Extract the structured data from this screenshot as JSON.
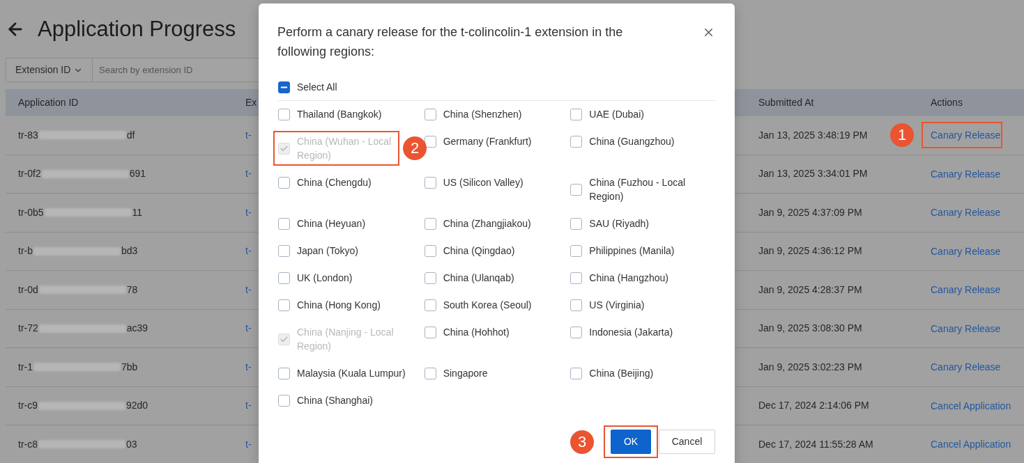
{
  "page": {
    "title": "Application Progress",
    "filter": {
      "field": "Extension ID",
      "placeholder": "Search by extension ID"
    }
  },
  "table": {
    "columns": [
      "Application ID",
      "Ex",
      "Submitted At",
      "Actions"
    ],
    "rows": [
      {
        "application_id": {
          "start": "tr-83",
          "end": "df"
        },
        "column_2": "t-",
        "submitted_at": "Jan 13, 2025 3:48:19 PM",
        "action": "Canary Release",
        "callout": {
          "number": "1"
        }
      },
      {
        "application_id": {
          "start": "tr-0f2",
          "end": "691"
        },
        "column_2": "t-",
        "submitted_at": "Jan 13, 2025 3:34:01 PM",
        "action": "Canary Release"
      },
      {
        "application_id": {
          "start": "tr-0b5",
          "end": "11"
        },
        "column_2": "t-",
        "submitted_at": "Jan 9, 2025 4:37:09 PM",
        "action": "Canary Release"
      },
      {
        "application_id": {
          "start": "tr-b",
          "end": "bd3"
        },
        "column_2": "t-",
        "submitted_at": "Jan 9, 2025 4:36:12 PM",
        "action": "Canary Release"
      },
      {
        "application_id": {
          "start": "tr-0d",
          "end": "78"
        },
        "column_2": "t-",
        "submitted_at": "Jan 9, 2025 4:28:37 PM",
        "action": "Canary Release"
      },
      {
        "application_id": {
          "start": "tr-72",
          "end": "ac39"
        },
        "column_2": "t-",
        "submitted_at": "Jan 9, 2025 3:08:30 PM",
        "action": "Canary Release"
      },
      {
        "application_id": {
          "start": "tr-1",
          "end": "7bb"
        },
        "column_2": "t-",
        "submitted_at": "Jan 9, 2025 3:02:23 PM",
        "action": "Canary Release"
      },
      {
        "application_id": {
          "start": "tr-c9",
          "end": "92d0"
        },
        "column_2": "t-",
        "submitted_at": "Dec 17, 2024 2:14:06 PM",
        "action": "Cancel Application"
      },
      {
        "application_id": {
          "start": "tr-c8",
          "end": "03"
        },
        "column_2": "t-",
        "submitted_at": "Dec 17, 2024 11:55:28 AM",
        "action": "Cancel Application"
      }
    ]
  },
  "modal": {
    "title": "Perform a canary release for the t-colincolin-1 extension in the following regions:",
    "select_all": {
      "label": "Select All",
      "indeterminate": true
    },
    "regions": [
      {
        "label": "Thailand (Bangkok)",
        "checked": false,
        "disabled": false
      },
      {
        "label": "China (Shenzhen)",
        "checked": false,
        "disabled": false
      },
      {
        "label": "UAE (Dubai)",
        "checked": false,
        "disabled": false
      },
      {
        "label": "China (Wuhan - Local Region)",
        "checked": true,
        "disabled": true,
        "callout": {
          "number": "2"
        }
      },
      {
        "label": "Germany (Frankfurt)",
        "checked": false,
        "disabled": false
      },
      {
        "label": "China (Guangzhou)",
        "checked": false,
        "disabled": false
      },
      {
        "label": "China (Chengdu)",
        "checked": false,
        "disabled": false
      },
      {
        "label": "US (Silicon Valley)",
        "checked": false,
        "disabled": false
      },
      {
        "label": "China (Fuzhou - Local Region)",
        "checked": false,
        "disabled": false
      },
      {
        "label": "China (Heyuan)",
        "checked": false,
        "disabled": false
      },
      {
        "label": "China (Zhangjiakou)",
        "checked": false,
        "disabled": false
      },
      {
        "label": "SAU (Riyadh)",
        "checked": false,
        "disabled": false
      },
      {
        "label": "Japan (Tokyo)",
        "checked": false,
        "disabled": false
      },
      {
        "label": "China (Qingdao)",
        "checked": false,
        "disabled": false
      },
      {
        "label": "Philippines (Manila)",
        "checked": false,
        "disabled": false
      },
      {
        "label": "UK (London)",
        "checked": false,
        "disabled": false
      },
      {
        "label": "China (Ulanqab)",
        "checked": false,
        "disabled": false
      },
      {
        "label": "China (Hangzhou)",
        "checked": false,
        "disabled": false
      },
      {
        "label": "China (Hong Kong)",
        "checked": false,
        "disabled": false
      },
      {
        "label": "South Korea (Seoul)",
        "checked": false,
        "disabled": false
      },
      {
        "label": "US (Virginia)",
        "checked": false,
        "disabled": false
      },
      {
        "label": "China (Nanjing - Local Region)",
        "checked": true,
        "disabled": true
      },
      {
        "label": "China (Hohhot)",
        "checked": false,
        "disabled": false
      },
      {
        "label": "Indonesia (Jakarta)",
        "checked": false,
        "disabled": false
      },
      {
        "label": "Malaysia (Kuala Lumpur)",
        "checked": false,
        "disabled": false
      },
      {
        "label": "Singapore",
        "checked": false,
        "disabled": false
      },
      {
        "label": "China (Beijing)",
        "checked": false,
        "disabled": false
      },
      {
        "label": "China (Shanghai)",
        "checked": false,
        "disabled": false
      }
    ],
    "buttons": [
      {
        "label": "OK",
        "kind": "primary",
        "callout": {
          "number": "3"
        }
      },
      {
        "label": "Cancel",
        "kind": "secondary"
      }
    ]
  }
}
